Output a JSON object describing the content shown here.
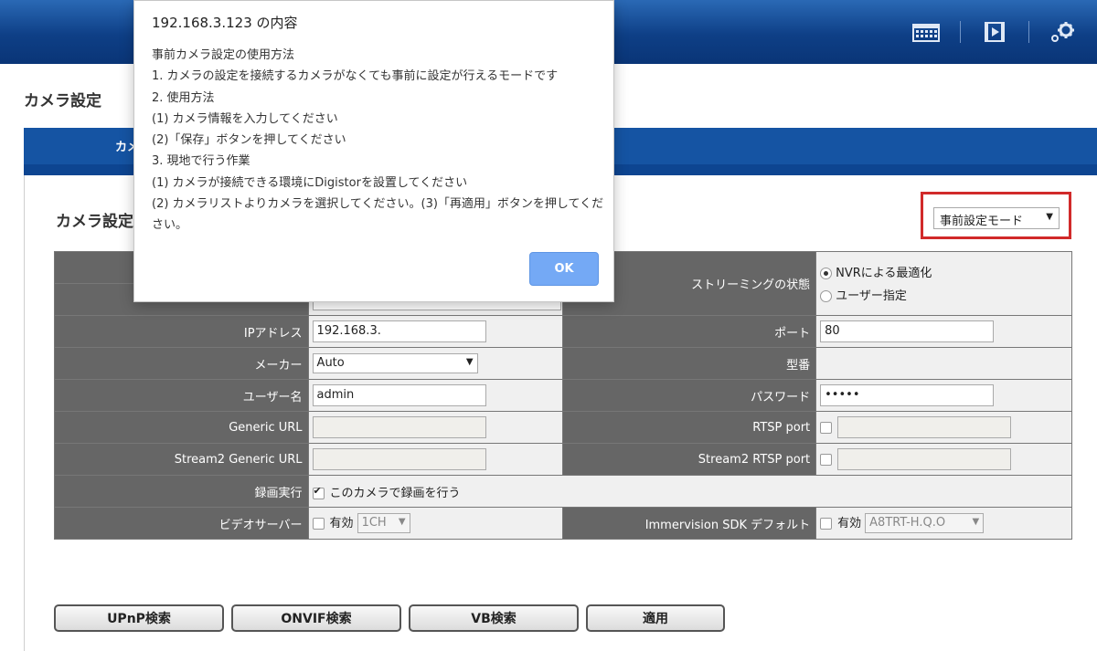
{
  "page": {
    "title": "カメラ設定",
    "tab_label": "カメ",
    "section_title": "カメラ設定"
  },
  "mode_select": {
    "value": "事前設定モード"
  },
  "form": {
    "row1_left_label": "",
    "row2_left_label": "",
    "row2_left_value": "",
    "streaming_label": "ストリーミングの状態",
    "streaming_option1": "NVRによる最適化",
    "streaming_option2": "ユーザー指定",
    "ip_label": "IPアドレス",
    "ip_value": "192.168.3.",
    "port_label": "ポート",
    "port_value": "80",
    "maker_label": "メーカー",
    "maker_value": "Auto",
    "model_label": "型番",
    "user_label": "ユーザー名",
    "user_value": "admin",
    "password_label": "パスワード",
    "password_value": "•••••",
    "generic_url_label": "Generic URL",
    "rtsp_port_label": "RTSP port",
    "stream2_url_label": "Stream2 Generic URL",
    "stream2_rtsp_label": "Stream2 RTSP port",
    "record_label": "録画実行",
    "record_check_label": "このカメラで録画を行う",
    "video_server_label": "ビデオサーバー",
    "video_server_enable": "有効",
    "video_server_value": "1CH",
    "immervision_label": "Immervision SDK デフォルト",
    "immervision_enable": "有効",
    "immervision_value": "A8TRT-H.Q.O"
  },
  "buttons": {
    "upnp": "UPnP検索",
    "onvif": "ONVIF検索",
    "vb": "VB検索",
    "apply": "適用"
  },
  "dialog": {
    "title": "192.168.3.123 の内容",
    "lines": [
      "事前カメラ設定の使用方法",
      "1. カメラの設定を接続するカメラがなくても事前に設定が行えるモードです",
      "2. 使用方法",
      "(1) カメラ情報を入力してください",
      "(2)「保存」ボタンを押してください",
      "3. 現地で行う作業",
      "(1) カメラが接続できる環境にDigistorを設置してください",
      "(2) カメラリストよりカメラを選択してください。(3)「再適用」ボタンを押してください。"
    ],
    "ok_label": "OK"
  },
  "colors": {
    "header_blue": "#0e3f86",
    "tab_blue": "#1554a3",
    "label_gray": "#666666",
    "highlight_red": "#d12a2a",
    "ok_blue": "#74a9f5"
  }
}
